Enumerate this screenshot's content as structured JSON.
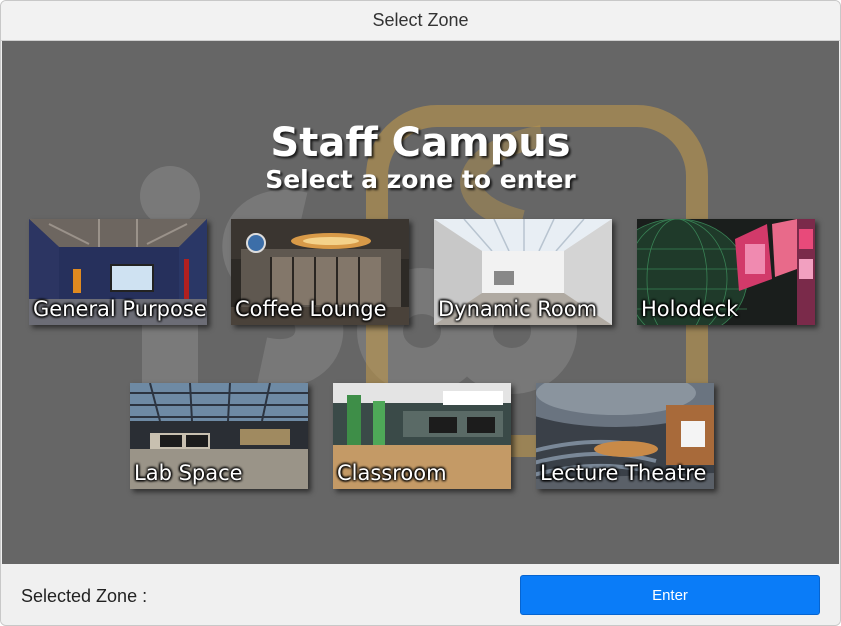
{
  "window": {
    "title": "Select Zone"
  },
  "header": {
    "title": "Staff Campus",
    "subtitle": "Select a zone to enter"
  },
  "zones": [
    {
      "label": "General Purpose"
    },
    {
      "label": "Coffee Lounge"
    },
    {
      "label": "Dynamic Room"
    },
    {
      "label": "Holodeck"
    },
    {
      "label": "Lab Space"
    },
    {
      "label": "Classroom"
    },
    {
      "label": "Lecture Theatre"
    }
  ],
  "footer": {
    "selected_label": "Selected Zone :",
    "enter_label": "Enter"
  },
  "colors": {
    "stage_bg": "#666666",
    "accent": "#0a7cf8"
  }
}
